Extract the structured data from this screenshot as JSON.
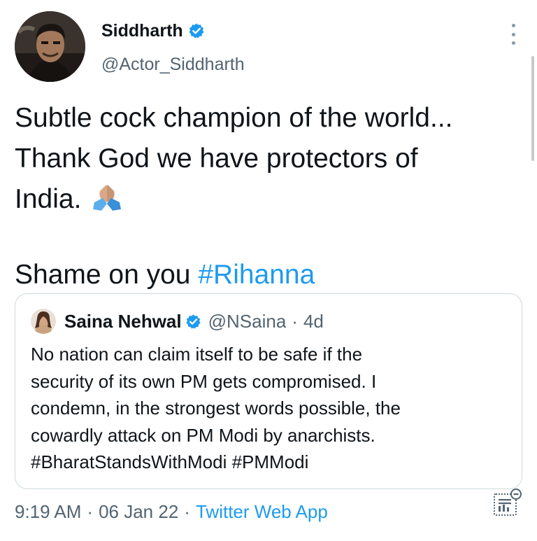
{
  "author": {
    "name": "Siddharth",
    "handle": "@Actor_Siddharth",
    "verified": true
  },
  "tweet": {
    "lines": [
      "Subtle cock champion of the world...",
      "Thank God we have protectors of",
      "India."
    ],
    "emoji": "folded-hands",
    "last_line_prefix": "Shame on you ",
    "hashtag": "#Rihanna"
  },
  "quoted_tweet": {
    "name": "Saina Nehwal",
    "handle": "@NSaina",
    "separator": "·",
    "time": "4d",
    "verified": true,
    "lines": [
      "No nation can claim itself to be safe if the",
      "security of its own PM gets compromised. I",
      "condemn, in the strongest words possible, the",
      "cowardly attack on PM Modi by anarchists.",
      "#BharatStandsWithModi #PMModi"
    ]
  },
  "footer": {
    "time": "9:19 AM",
    "separator": "·",
    "date": "06 Jan 22",
    "separator2": "·",
    "source": "Twitter Web App"
  },
  "icons": {
    "verified": "verified-badge-icon",
    "more": "more-options-icon",
    "analytics": "tweet-analytics-icon"
  },
  "colors": {
    "accent": "#1d9bf0",
    "secondary_text": "#536471",
    "border": "#cfd9de",
    "text": "#0f1419"
  }
}
